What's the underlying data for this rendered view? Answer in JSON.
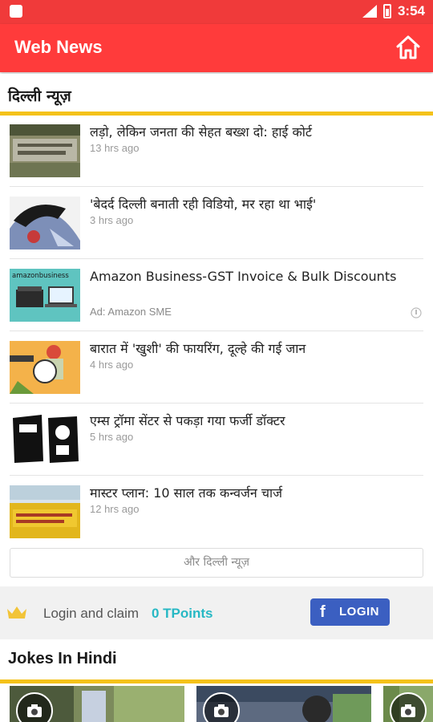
{
  "status_bar": {
    "time": "3:54",
    "network": "LTE"
  },
  "app_bar": {
    "title": "Web News",
    "home_icon": "home-icon"
  },
  "delhi_section": {
    "title": "दिल्ली न्यूज़",
    "items": [
      {
        "title": "लड़ो, लेकिन जनता की सेहत बख्श दो: हाई कोर्ट",
        "time": "13 hrs ago"
      },
      {
        "title": "'बेदर्द दिल्ली बनाती रही विडियो, मर रहा था भाई'",
        "time": "3 hrs ago"
      },
      {
        "title": "Amazon Business-GST Invoice & Bulk Discounts",
        "time": "Ad: Amazon SME",
        "thumb_text": "amazonbusiness",
        "is_ad": true
      },
      {
        "title": "बारात में 'खुशी' की फायरिंग, दूल्हे की गई जान",
        "time": "4 hrs ago"
      },
      {
        "title": "एम्स ट्रॉमा सेंटर से पकड़ा गया फर्जी डॉक्टर",
        "time": "5 hrs ago"
      },
      {
        "title": "मास्टर प्लान: 10 साल तक कन्वर्जन चार्ज",
        "time": "12 hrs ago"
      }
    ],
    "more_label": "और दिल्ली न्यूज़"
  },
  "login_band": {
    "claim_text": "Login and claim",
    "points": "0 TPoints",
    "login_label": "LOGIN"
  },
  "jokes_section": {
    "title": "Jokes In Hindi"
  },
  "colors": {
    "primary": "#ff3b3b",
    "accent_yellow": "#f4c21a",
    "tpoints": "#26b8c4",
    "facebook": "#3b5fc1"
  }
}
